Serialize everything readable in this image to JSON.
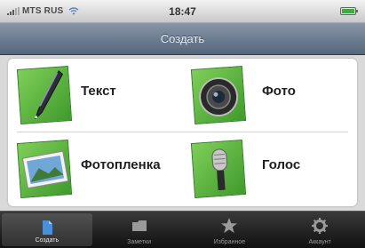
{
  "status_bar": {
    "carrier": "MTS RUS",
    "time": "18:47",
    "battery_level": 1.0
  },
  "nav": {
    "title": "Создать"
  },
  "main": {
    "items": [
      {
        "label": "Текст",
        "icon": "pen-icon"
      },
      {
        "label": "Фото",
        "icon": "camera-icon"
      },
      {
        "label": "Фотопленка",
        "icon": "photo-roll-icon"
      },
      {
        "label": "Голос",
        "icon": "microphone-icon"
      }
    ]
  },
  "tab_bar": {
    "tabs": [
      {
        "label": "Создать",
        "icon": "document-icon",
        "active": true
      },
      {
        "label": "Заметки",
        "icon": "folder-icon",
        "active": false
      },
      {
        "label": "Избранное",
        "icon": "star-icon",
        "active": false
      },
      {
        "label": "Аккаунт",
        "icon": "gear-icon",
        "active": false
      }
    ]
  },
  "colors": {
    "nav_top": "#8795a6",
    "nav_bottom": "#55667c",
    "icon_green": "#5cb63f",
    "tab_bar": "#1a1a1a"
  }
}
